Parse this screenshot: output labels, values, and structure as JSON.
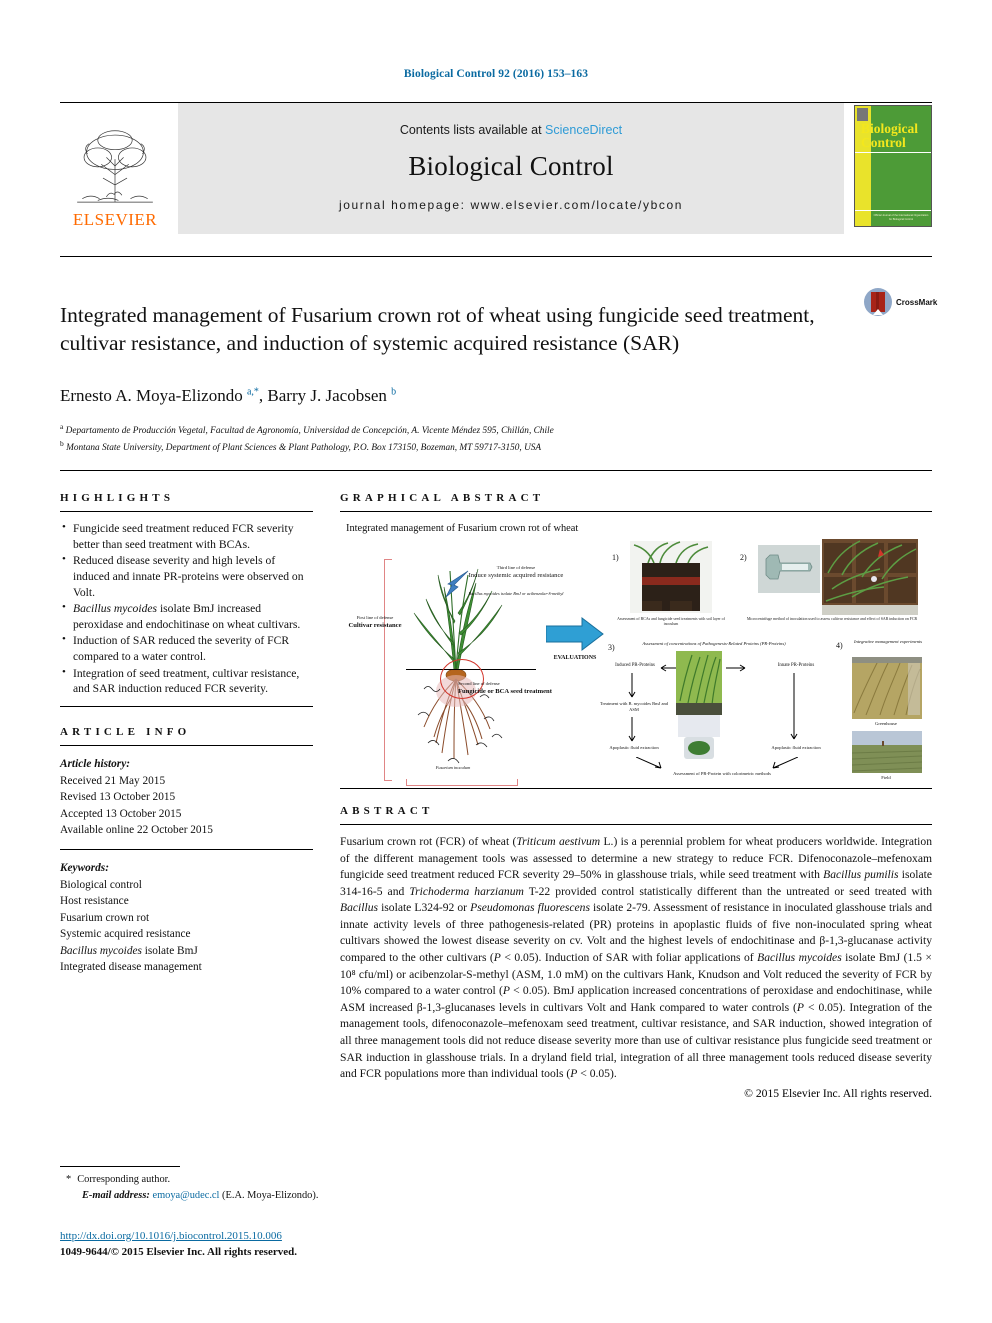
{
  "running_head": "Biological Control 92 (2016) 153–163",
  "masthead": {
    "publisher_name": "ELSEVIER",
    "contents_prefix": "Contents lists available at",
    "contents_link": "ScienceDirect",
    "journal_name": "Biological Control",
    "homepage": "journal homepage: www.elsevier.com/locate/ybcon",
    "cover_title_line1": "Biological",
    "cover_title_line2": "Control",
    "cover_footer": "Official Journal of the International Organization for Biological Control"
  },
  "article": {
    "title": "Integrated management of Fusarium crown rot of wheat using fungicide seed treatment, cultivar resistance, and induction of systemic acquired resistance (SAR)",
    "crossmark_label": "CrossMark",
    "authors_html": "Ernesto A. Moya-Elizondo <sup>a,*</sup>, Barry J. Jacobsen <sup>b</sup>",
    "affiliation_a": "Departamento de Producción Vegetal, Facultad de Agronomía, Universidad de Concepción, A. Vicente Méndez 595, Chillán, Chile",
    "affiliation_b": "Montana State University, Department of Plant Sciences & Plant Pathology, P.O. Box 173150, Bozeman, MT 59717-3150, USA"
  },
  "highlights": {
    "heading": "HIGHLIGHTS",
    "items": [
      "Fungicide seed treatment reduced FCR severity better than seed treatment with BCAs.",
      "Reduced disease severity and high levels of induced and innate PR-proteins were observed on Volt.",
      "Bacillus mycoides isolate BmJ increased peroxidase and endochitinase on wheat cultivars.",
      "Induction of SAR reduced the severity of FCR compared to a water control.",
      "Integration of seed treatment, cultivar resistance, and SAR induction reduced FCR severity."
    ],
    "italic_prefixes": [
      "",
      "",
      "Bacillus mycoides",
      "",
      ""
    ]
  },
  "article_info": {
    "heading": "ARTICLE INFO",
    "history_label": "Article history:",
    "history": [
      "Received 21 May 2015",
      "Revised 13 October 2015",
      "Accepted 13 October 2015",
      "Available online 22 October 2015"
    ],
    "keywords_label": "Keywords:",
    "keywords": [
      "Biological control",
      "Host resistance",
      "Fusarium crown rot",
      "Systemic acquired resistance",
      "Bacillus mycoides isolate BmJ",
      "Integrated disease management"
    ]
  },
  "graphical_abstract": {
    "heading": "GRAPHICAL ABSTRACT",
    "figure_title": "Integrated management of Fusarium crown rot of wheat",
    "first_line_label": "First line of defense",
    "first_line_text": "Cultivar resistance",
    "second_line_label": "Second line of defense",
    "second_line_text": "Fungicide or BCA seed treatment",
    "third_line_label": "Third line of defense",
    "third_line_text": "Induce systemic acquired resistance",
    "third_line_sub": "Bacillus mycoides isolate BmJ or acibenzolar-S-methyl",
    "fusarium_label": "Fusarium inoculum",
    "evaluations_label": "EVALUATIONS",
    "panel1_num": "1)",
    "panel1_caption": "Assessment of BCAs and fungicide seed treatments with soil layer of inoculum",
    "panel2_num": "2)",
    "panel2_caption": "Microcentrifuge method of inoculation used to assess cultivar resistance and effect of SAR induction on FCR",
    "panel3_num": "3)",
    "panel3_caption": "Assessment of concentrations of Pathogenesis-Related Proteins (PR-Proteins)",
    "panel3_left": "Induced PR-Proteins",
    "panel3_right": "Innate PR-Proteins",
    "panel3_treatment": "Treatment with B. mycoides BmJ and ASM",
    "panel3_apoplastic_left": "Apoplastic fluid extraction",
    "panel3_apoplastic_right": "Apoplastic fluid extraction",
    "panel3_bottom": "Assessment of PR-Protein with colorimetric methods",
    "panel4_num": "4)",
    "panel4_caption": "Integrative management experiments",
    "panel4_label1": "Greenhouse",
    "panel4_label2": "Field"
  },
  "abstract": {
    "heading": "ABSTRACT",
    "paragraphs": [
      "Fusarium crown rot (FCR) of wheat (Triticum aestivum L.) is a perennial problem for wheat producers worldwide. Integration of the different management tools was assessed to determine a new strategy to reduce FCR. Difenoconazole–mefenoxam fungicide seed treatment reduced FCR severity 29–50% in glasshouse trials, while seed treatment with Bacillus pumilis isolate 314-16-5 and Trichoderma harzianum T-22 provided control statistically different than the untreated or seed treated with Bacillus isolate L324-92 or Pseudomonas fluorescens isolate 2-79. Assessment of resistance in inoculated glasshouse trials and innate activity levels of three pathogenesis-related (PR) proteins in apoplastic fluids of five non-inoculated spring wheat cultivars showed the lowest disease severity on cv. Volt and the highest levels of endochitinase and β-1,3-glucanase activity compared to the other cultivars (P < 0.05). Induction of SAR with foliar applications of Bacillus mycoides isolate BmJ (1.5 × 10⁸ cfu/ml) or acibenzolar-S-methyl (ASM, 1.0 mM) on the cultivars Hank, Knudson and Volt reduced the severity of FCR by 10% compared to a water control (P < 0.05). BmJ application increased concentrations of peroxidase and endochitinase, while ASM increased β-1,3-glucanases levels in cultivars Volt and Hank compared to water controls (P < 0.05). Integration of the management tools, difenoconazole–mefenoxam seed treatment, cultivar resistance, and SAR induction, showed integration of all three management tools did not reduce disease severity more than use of cultivar resistance plus fungicide seed treatment or SAR induction in glasshouse trials. In a dryland field trial, integration of all three management tools reduced disease severity and FCR populations more than individual tools (P < 0.05)."
    ],
    "copyright": "© 2015 Elsevier Inc. All rights reserved."
  },
  "footer": {
    "corresponding_star": "*",
    "corresponding_label": "Corresponding author.",
    "email_label": "E-mail address:",
    "email": "emoya@udec.cl",
    "email_suffix": "(E.A. Moya-Elizondo).",
    "doi": "http://dx.doi.org/10.1016/j.biocontrol.2015.10.006",
    "issn_line": "1049-9644/© 2015 Elsevier Inc. All rights reserved."
  },
  "colors": {
    "link": "#0a6aa1",
    "sciencedirect": "#2e9bd6",
    "elsevier_orange": "#ff6a00",
    "cover_green": "#4d9b37",
    "cover_yellow": "#e9e32b"
  }
}
